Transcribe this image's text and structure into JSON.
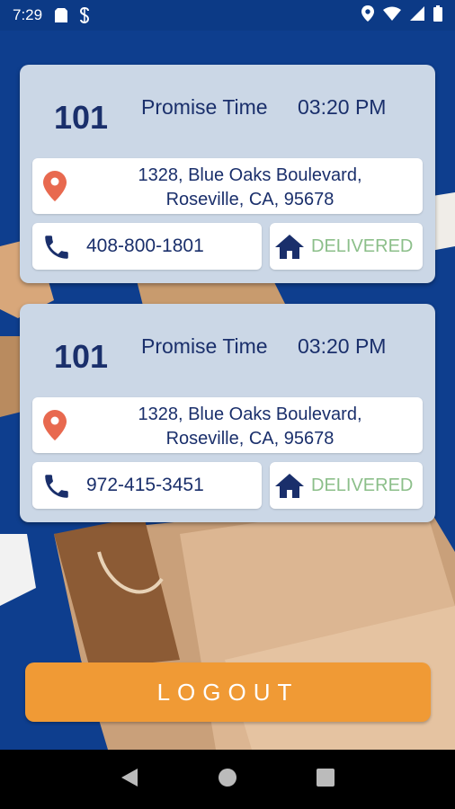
{
  "status_bar": {
    "time": "7:29",
    "icons": [
      "sd-card-icon",
      "s-sync-icon",
      "location-icon",
      "wifi-icon",
      "signal-icon",
      "battery-icon"
    ]
  },
  "orders": [
    {
      "order_number": "101",
      "promise_label": "Promise Time",
      "promise_time": "03:20 PM",
      "address_line1": "1328, Blue Oaks Boulevard,",
      "address_line2": "Roseville, CA, 95678",
      "phone": "408-800-1801",
      "status": "DELIVERED"
    },
    {
      "order_number": "101",
      "promise_label": "Promise Time",
      "promise_time": "03:20 PM",
      "address_line1": "1328, Blue Oaks Boulevard,",
      "address_line2": "Roseville, CA, 95678",
      "phone": "972-415-3451",
      "status": "DELIVERED"
    }
  ],
  "logout_label": "LOGOUT",
  "colors": {
    "background": "#0f3f8f",
    "card": "#cbd7e6",
    "text_primary": "#1a2f6b",
    "pin": "#e8694f",
    "delivered": "#8cbf8a",
    "logout": "#f09a35"
  }
}
